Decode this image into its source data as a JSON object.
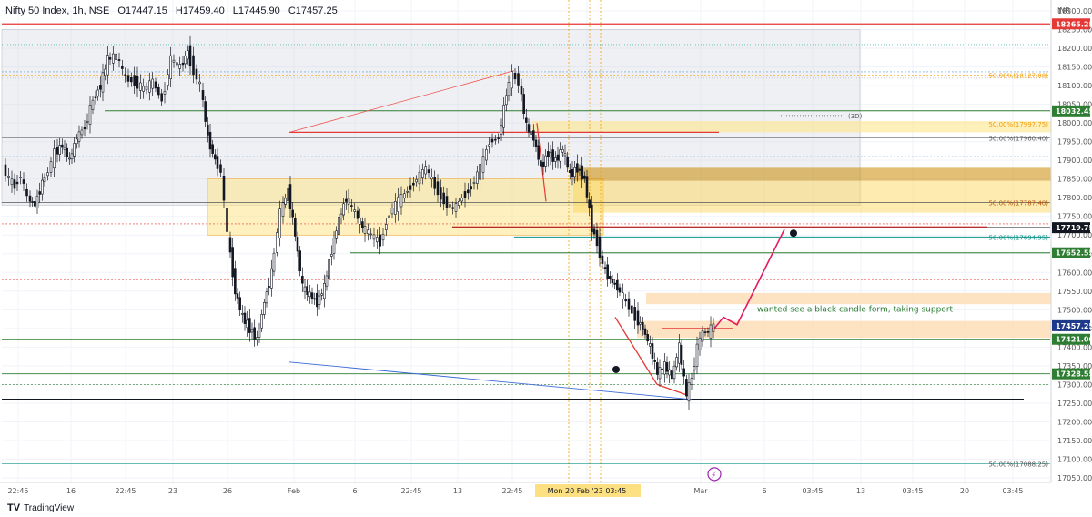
{
  "header": {
    "symbol": "Nifty 50 Index, 1h, NSE",
    "open": "O17447.15",
    "high": "H17459.40",
    "low": "L17445.90",
    "close": "C17457.25"
  },
  "currency": "INR",
  "footer": {
    "logo": "TV",
    "brand": "TradingView"
  },
  "chart_data": {
    "type": "line",
    "ylim": [
      17030,
      18350
    ],
    "y_ticks": [
      18300,
      18250,
      18200,
      18150,
      18100,
      18050,
      18000,
      17950,
      17900,
      17850,
      17800,
      17750,
      17700,
      17650,
      17600,
      17550,
      17500,
      17450,
      17400,
      17350,
      17300,
      17250,
      17200,
      17150,
      17100,
      17050
    ],
    "y_tick_labels": [
      "18300.00",
      "18250.00",
      "18200.00",
      "18150.00",
      "18100.00",
      "18050.00",
      "18000.00",
      "17950.00",
      "17900.00",
      "17850.00",
      "17800.00",
      "17750.00",
      "17700.00",
      "17650.00",
      "17600.00",
      "17550.00",
      "17500.00",
      "17450.00",
      "17400.00",
      "17350.00",
      "17300.00",
      "17250.00",
      "17200.00",
      "17150.00",
      "17100.00",
      "17050.00"
    ],
    "x_ticks": [
      {
        "label": "22:45",
        "x": 20
      },
      {
        "label": "16",
        "x": 78
      },
      {
        "label": "22:45",
        "x": 138
      },
      {
        "label": "23",
        "x": 190
      },
      {
        "label": "26",
        "x": 250
      },
      {
        "label": "Feb",
        "x": 323
      },
      {
        "label": "6",
        "x": 390
      },
      {
        "label": "22:45",
        "x": 452
      },
      {
        "label": "13",
        "x": 503
      },
      {
        "label": "22:45",
        "x": 563
      },
      {
        "label": "Mon 20 Feb '23 03:45",
        "x": 645
      },
      {
        "label": "Mar",
        "x": 770
      },
      {
        "label": "6",
        "x": 840
      },
      {
        "label": "03:45",
        "x": 893
      },
      {
        "label": "13",
        "x": 946
      },
      {
        "label": "03:45",
        "x": 1003
      },
      {
        "label": "20",
        "x": 1060
      },
      {
        "label": "03:45",
        "x": 1113
      }
    ],
    "price_labels": [
      {
        "value": 18265.25,
        "label": "18265.25",
        "color": "#e53935"
      },
      {
        "value": 18032.45,
        "label": "18032.45",
        "color": "#2e7d32"
      },
      {
        "value": 17719.75,
        "label": "17719.75",
        "color": "#131722"
      },
      {
        "value": 17652.55,
        "label": "17652.55",
        "color": "#2e7d32"
      },
      {
        "value": 17457.25,
        "label": "17457.25",
        "color": "#1e3a8a"
      },
      {
        "value": 17421.0,
        "label": "17421.00",
        "color": "#2e7d32"
      },
      {
        "value": 17328.55,
        "label": "17328.55",
        "color": "#2e7d32"
      }
    ],
    "fib_labels": [
      {
        "value": 18127.8,
        "label": "50.00%(18127.80)",
        "color": "#f59e0b"
      },
      {
        "value": 17997.75,
        "label": "50.00%(17997.75)",
        "color": "#f59e0b"
      },
      {
        "value": 17960.4,
        "label": "50.00%(17960.40)",
        "color": "#555555"
      },
      {
        "value": 17787.4,
        "label": "50.00%(17787.40)",
        "color": "#b45309"
      },
      {
        "value": 17694.95,
        "label": "50.00%(17694.95)",
        "color": "#0d9488"
      },
      {
        "value": 17088.25,
        "label": "50.00%(17088.25)",
        "color": "#555555"
      }
    ],
    "annotation": "wanted see a black candle form, taking support",
    "tag_3d": "(3D)",
    "series": [
      {
        "values": [
          [
            5,
            17880
          ],
          [
            12,
            17850
          ],
          [
            18,
            17830
          ],
          [
            25,
            17860
          ],
          [
            32,
            17800
          ],
          [
            40,
            17780
          ],
          [
            48,
            17840
          ],
          [
            55,
            17870
          ],
          [
            62,
            17920
          ],
          [
            70,
            17940
          ],
          [
            78,
            17900
          ],
          [
            86,
            17960
          ],
          [
            95,
            17990
          ],
          [
            104,
            18060
          ],
          [
            112,
            18100
          ],
          [
            120,
            18170
          ],
          [
            130,
            18180
          ],
          [
            140,
            18120
          ],
          [
            150,
            18110
          ],
          [
            160,
            18090
          ],
          [
            170,
            18110
          ],
          [
            180,
            18060
          ],
          [
            190,
            18170
          ],
          [
            200,
            18150
          ],
          [
            208,
            18190
          ],
          [
            215,
            18140
          ],
          [
            222,
            18100
          ],
          [
            230,
            17960
          ],
          [
            238,
            17900
          ],
          [
            245,
            17870
          ],
          [
            252,
            17700
          ],
          [
            260,
            17550
          ],
          [
            268,
            17480
          ],
          [
            276,
            17450
          ],
          [
            284,
            17420
          ],
          [
            292,
            17520
          ],
          [
            300,
            17600
          ],
          [
            310,
            17760
          ],
          [
            318,
            17820
          ],
          [
            326,
            17700
          ],
          [
            334,
            17560
          ],
          [
            342,
            17540
          ],
          [
            350,
            17520
          ],
          [
            358,
            17560
          ],
          [
            366,
            17660
          ],
          [
            374,
            17740
          ],
          [
            382,
            17800
          ],
          [
            392,
            17760
          ],
          [
            400,
            17720
          ],
          [
            410,
            17700
          ],
          [
            420,
            17680
          ],
          [
            430,
            17760
          ],
          [
            440,
            17790
          ],
          [
            450,
            17820
          ],
          [
            460,
            17850
          ],
          [
            470,
            17880
          ],
          [
            480,
            17830
          ],
          [
            490,
            17790
          ],
          [
            500,
            17770
          ],
          [
            510,
            17800
          ],
          [
            520,
            17830
          ],
          [
            530,
            17880
          ],
          [
            540,
            17950
          ],
          [
            550,
            17960
          ],
          [
            558,
            18080
          ],
          [
            565,
            18130
          ],
          [
            572,
            18110
          ],
          [
            580,
            17990
          ],
          [
            588,
            17960
          ],
          [
            596,
            17880
          ],
          [
            604,
            17920
          ],
          [
            612,
            17900
          ],
          [
            620,
            17930
          ],
          [
            628,
            17860
          ],
          [
            636,
            17880
          ],
          [
            644,
            17850
          ],
          [
            652,
            17720
          ],
          [
            658,
            17680
          ],
          [
            664,
            17620
          ],
          [
            672,
            17580
          ],
          [
            680,
            17560
          ],
          [
            690,
            17520
          ],
          [
            700,
            17480
          ],
          [
            708,
            17450
          ],
          [
            716,
            17400
          ],
          [
            724,
            17330
          ],
          [
            732,
            17350
          ],
          [
            740,
            17320
          ],
          [
            748,
            17400
          ],
          [
            756,
            17270
          ],
          [
            762,
            17320
          ],
          [
            768,
            17400
          ],
          [
            774,
            17440
          ],
          [
            780,
            17440
          ],
          [
            786,
            17457
          ]
        ]
      }
    ]
  }
}
